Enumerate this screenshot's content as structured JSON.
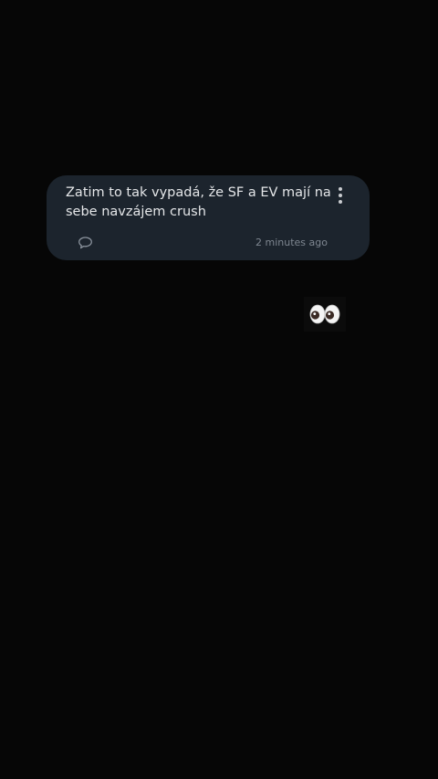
{
  "message": {
    "text": "Zatim to tak vypadá, že SF a EV mají na sebe navzájem crush",
    "timestamp": "2 minutes ago"
  },
  "icons": {
    "more": "more-vertical-icon",
    "comment": "comment-bubble-icon",
    "reaction": "eyes-emoji-icon"
  },
  "colors": {
    "background": "#060606",
    "card": "#1c242d",
    "text": "#e4e6e8",
    "muted": "#7e8690"
  }
}
